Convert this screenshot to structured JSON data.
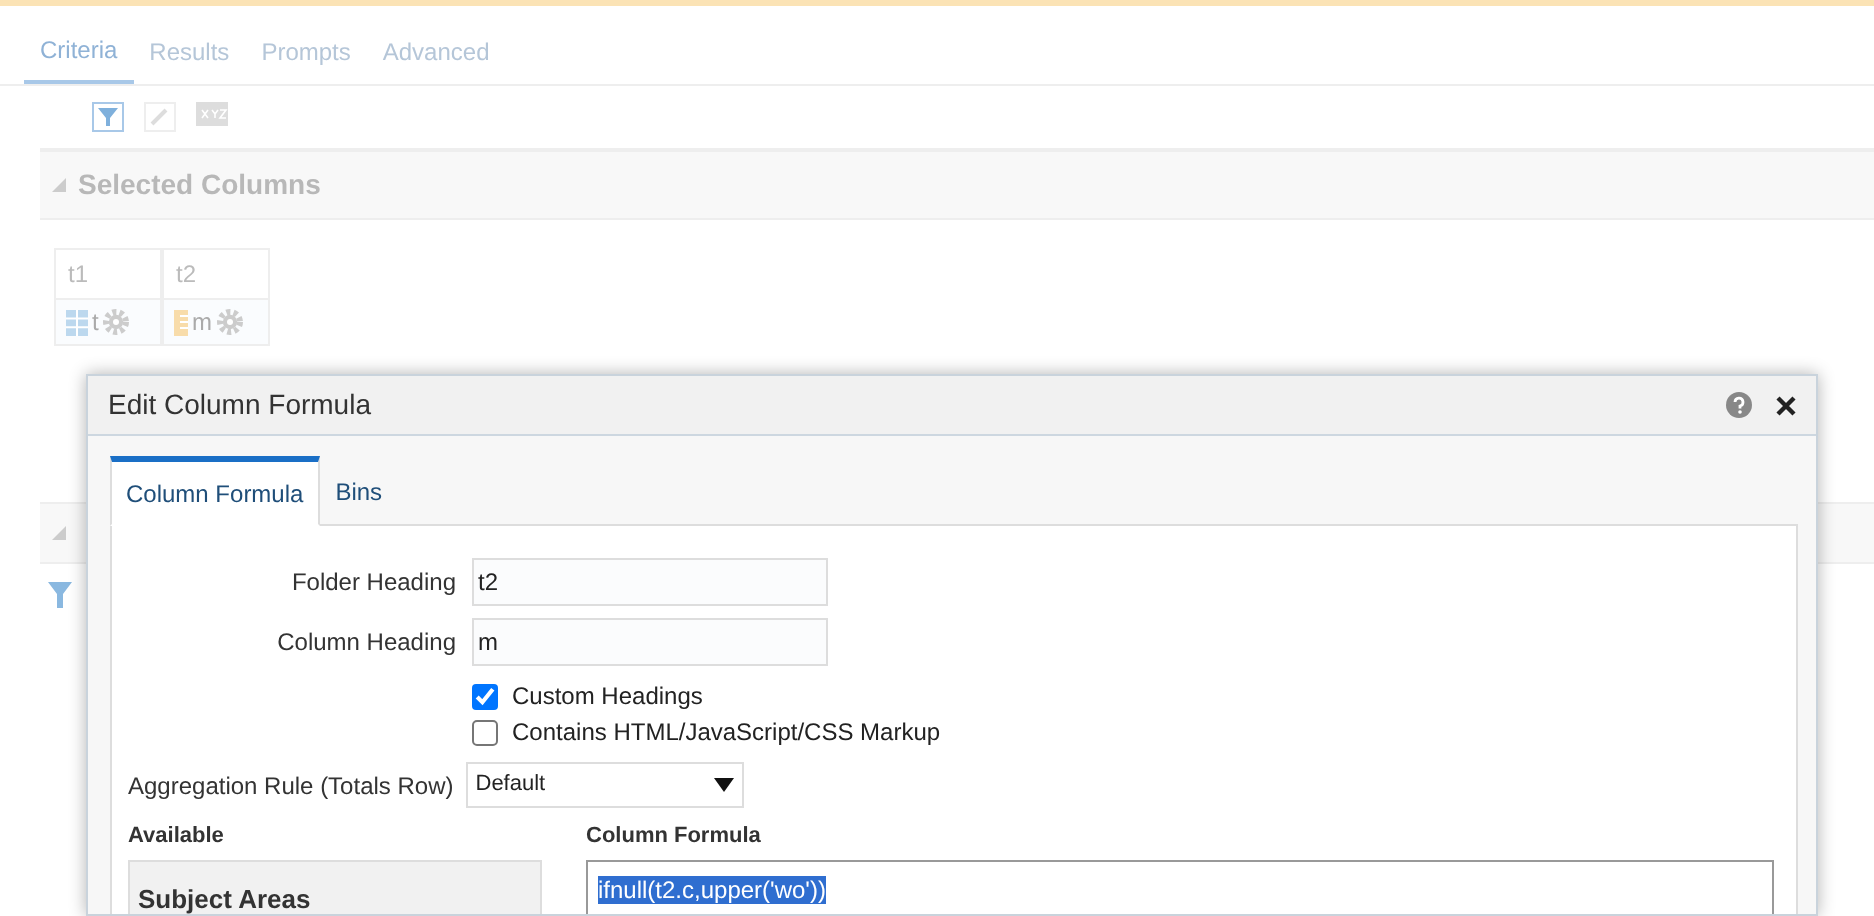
{
  "tabs": [
    {
      "label": "Criteria",
      "selected": true
    },
    {
      "label": "Results",
      "selected": false
    },
    {
      "label": "Prompts",
      "selected": false
    },
    {
      "label": "Advanced",
      "selected": false
    }
  ],
  "selected_columns": {
    "title": "Selected Columns",
    "expanded": true,
    "columns": [
      {
        "folder": "t1",
        "name": "t",
        "kind": "attribute"
      },
      {
        "folder": "t2",
        "name": "m",
        "kind": "measure"
      }
    ]
  },
  "filters_panel": {
    "expanded": true
  },
  "dialog": {
    "title": "Edit Column Formula",
    "tabs": [
      {
        "label": "Column Formula",
        "selected": true
      },
      {
        "label": "Bins",
        "selected": false
      }
    ],
    "fields": [
      {
        "label": "Folder Heading",
        "value": "t2"
      },
      {
        "label": "Column Heading",
        "value": "m"
      }
    ],
    "checkboxes": [
      {
        "label": "Custom Headings",
        "checked": true
      },
      {
        "label": "Contains HTML/JavaScript/CSS Markup",
        "checked": false
      }
    ],
    "aggregation": {
      "label": "Aggregation Rule (Totals Row)",
      "value": "Default"
    },
    "available": {
      "label": "Available",
      "title": "Subject Areas"
    },
    "formula": {
      "label": "Column Formula",
      "value": "ifnull(t2.c,upper('wo'))",
      "selected": true
    }
  }
}
